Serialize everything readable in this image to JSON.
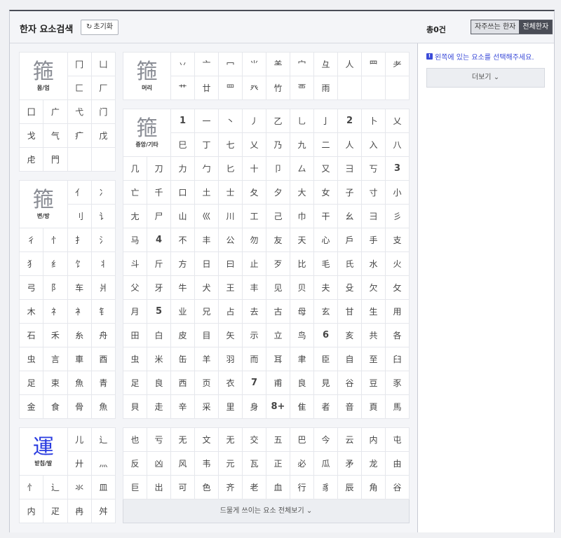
{
  "left_header": {
    "title": "한자 요소검색",
    "reset_label": "초기화"
  },
  "right_header": {
    "count": "총0건",
    "tab_frequent": "자주쓰는 한자",
    "tab_all": "전체한자"
  },
  "right_body": {
    "info_text": "왼쪽에 있는 요소를 선택해주세요.",
    "more_label": "더보기"
  },
  "rare_label": "드물게 쓰이는 요소 전체보기",
  "shape_panel": {
    "sample": "箍",
    "label": "몸/엄",
    "items": [
      "冂",
      "凵",
      "匚",
      "厂",
      "囗",
      "广",
      "弋",
      "门",
      "戈",
      "气",
      "疒",
      "戊",
      "虍",
      "門",
      "",
      ""
    ]
  },
  "head_panel": {
    "sample": "箍",
    "label": "머리",
    "items": [
      "丷",
      "亠",
      "冖",
      "⺌",
      "⺷",
      "宀",
      "彑",
      "⼈",
      "⺲",
      "耂",
      "艹",
      "廿",
      "罒",
      "癶",
      "竹",
      "覀",
      "雨",
      "",
      "",
      ""
    ]
  },
  "side_panel": {
    "sample": "箍",
    "label": "변/방",
    "items": [
      "亻",
      "冫",
      "刂",
      "讠",
      "彳",
      "忄",
      "扌",
      "氵",
      "犭",
      "纟",
      "饣",
      "丬",
      "弓",
      "阝",
      "车",
      "爿",
      "木",
      "礻",
      "衤",
      "钅",
      "石",
      "禾",
      "糸",
      "舟",
      "虫",
      "言",
      "車",
      "酉",
      "足",
      "束",
      "魚",
      "青",
      "金",
      "食",
      "骨",
      "魚"
    ]
  },
  "mid_panel": {
    "sample": "箍",
    "label": "중앙/기타",
    "items": [
      "1",
      "一",
      "丶",
      "丿",
      "乙",
      "乚",
      "亅",
      "2",
      "卜",
      "乂",
      "巳",
      "丁",
      "七",
      "乂",
      "乃",
      "九",
      "二",
      "人",
      "入",
      "八",
      "几",
      "刀",
      "力",
      "勹",
      "匕",
      "十",
      "卩",
      "厶",
      "又",
      "⺕",
      "丂",
      "3",
      "亡",
      "千",
      "口",
      "土",
      "士",
      "夂",
      "夕",
      "大",
      "女",
      "子",
      "寸",
      "小",
      "尢",
      "尸",
      "山",
      "巛",
      "川",
      "工",
      "己",
      "巾",
      "干",
      "幺",
      "彐",
      "彡",
      "马",
      "4",
      "不",
      "丰",
      "公",
      "勿",
      "友",
      "天",
      "心",
      "戶",
      "手",
      "支",
      "斗",
      "斤",
      "方",
      "日",
      "曰",
      "止",
      "歹",
      "比",
      "毛",
      "氏",
      "水",
      "火",
      "父",
      "牙",
      "牛",
      "犬",
      "王",
      "丰",
      "见",
      "贝",
      "夫",
      "殳",
      "欠",
      "攵",
      "月",
      "5",
      "业",
      "兄",
      "占",
      "去",
      "古",
      "母",
      "玄",
      "甘",
      "生",
      "用",
      "田",
      "白",
      "皮",
      "目",
      "矢",
      "示",
      "立",
      "鸟",
      "6",
      "亥",
      "共",
      "各",
      "虫",
      "米",
      "缶",
      "羊",
      "羽",
      "而",
      "耳",
      "聿",
      "臣",
      "自",
      "至",
      "臼",
      "足",
      "良",
      "西",
      "页",
      "衣",
      "7",
      "甫",
      "良",
      "見",
      "谷",
      "豆",
      "豕",
      "貝",
      "走",
      "辛",
      "采",
      "里",
      "身",
      "8+",
      "隹",
      "者",
      "音",
      "頁",
      "馬"
    ]
  },
  "bottom_panel": {
    "sample": "運",
    "label": "받침/발",
    "items": [
      "儿",
      "辶",
      "廾",
      "灬",
      "忄",
      "辶",
      "氺",
      "皿",
      "内",
      "疋",
      "冉",
      "舛"
    ]
  },
  "rare_panel": {
    "items": [
      "也",
      "亏",
      "无",
      "文",
      "无",
      "交",
      "五",
      "巴",
      "今",
      "云",
      "内",
      "屯",
      "反",
      "凶",
      "风",
      "韦",
      "元",
      "瓦",
      "正",
      "必",
      "瓜",
      "矛",
      "龙",
      "由",
      "巨",
      "出",
      "可",
      "色",
      "齐",
      "老",
      "血",
      "行",
      "豸",
      "辰",
      "角",
      "谷"
    ]
  }
}
